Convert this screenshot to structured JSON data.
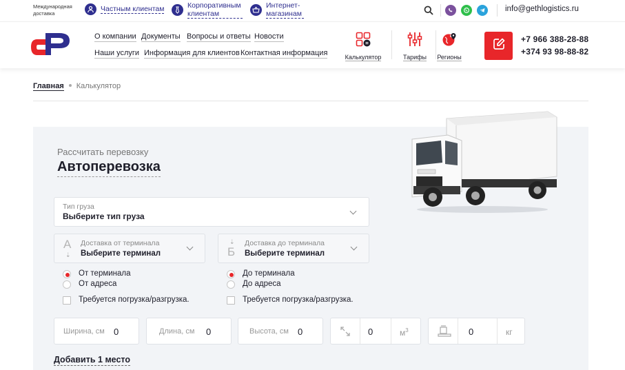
{
  "topbar": {
    "intl_label": "Международная доставка",
    "segments": [
      {
        "label": "Частным клиентам"
      },
      {
        "label": "Корпоративным клиентам"
      },
      {
        "label": "Интернет-магазинам"
      }
    ],
    "email": "info@gethlogistics.ru"
  },
  "header": {
    "nav_row1": [
      "О компании",
      "Документы",
      "Вопросы и ответы",
      "Новости"
    ],
    "nav_row2": [
      "Наши услуги",
      "Информация для клиентов",
      "Контактная информация"
    ],
    "tools": [
      {
        "label": "Калькулятор",
        "icon": "calculator-icon"
      },
      {
        "label": "Тарифы",
        "icon": "sliders-icon"
      },
      {
        "label": "Регионы",
        "icon": "globe-pin-icon"
      }
    ],
    "phones": [
      "+7 966 388-28-88",
      "+374 93 98-88-82"
    ]
  },
  "breadcrumb": {
    "home": "Главная",
    "current": "Калькулятор"
  },
  "calculator": {
    "subtitle": "Рассчитать перевозку",
    "title": "Автоперевозка",
    "cargo_type": {
      "label": "Тип груза",
      "value": "Выберите тип груза"
    },
    "from": {
      "letter": "А",
      "label": "Доставка от терминала",
      "value": "Выберите терминал"
    },
    "to": {
      "letter": "Б",
      "label": "Доставка до терминала",
      "value": "Выберите терминал"
    },
    "from_options": [
      {
        "label": "От терминала",
        "selected": true
      },
      {
        "label": "От адреса",
        "selected": false
      }
    ],
    "to_options": [
      {
        "label": "До терминала",
        "selected": true
      },
      {
        "label": "До адреса",
        "selected": false
      }
    ],
    "loading_label": "Требуется погрузка/разгрузка.",
    "width": {
      "label": "Ширина, см",
      "value": "0"
    },
    "length": {
      "label": "Длина, см",
      "value": "0"
    },
    "height": {
      "label": "Высота, см",
      "value": "0"
    },
    "volume": {
      "value": "0",
      "unit": "м",
      "unit_sup": "3"
    },
    "weight": {
      "value": "0",
      "unit": "кг"
    },
    "add_place": "Добавить 1 место"
  },
  "colors": {
    "brand_red": "#e8262a",
    "brand_navy": "#2f2f8f",
    "panel_bg": "#f2f4f7"
  }
}
